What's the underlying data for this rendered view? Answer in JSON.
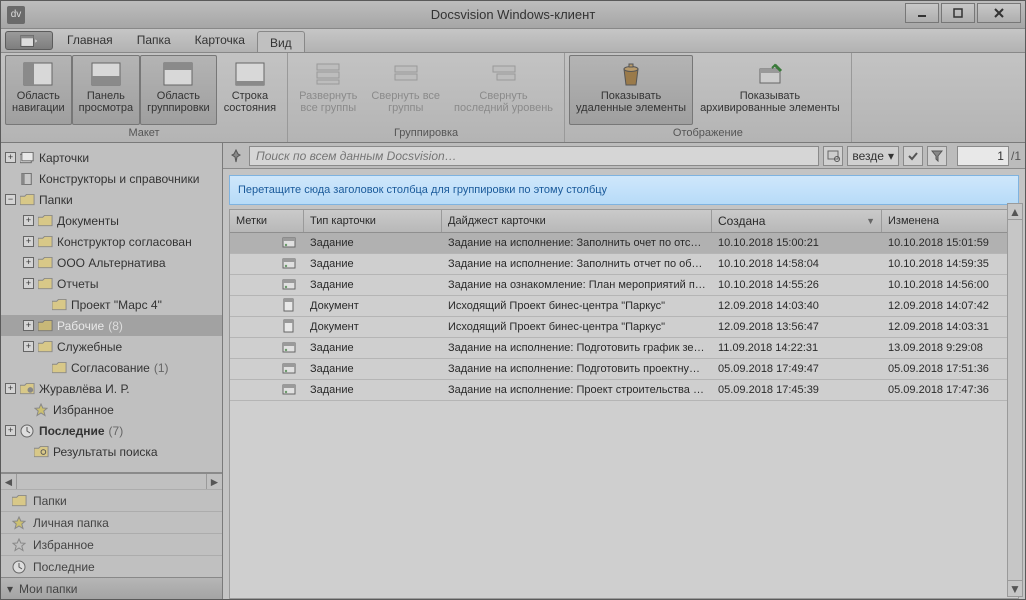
{
  "window": {
    "title": "Docsvision Windows-клиент"
  },
  "tabs": {
    "main": "Главная",
    "folder": "Папка",
    "card": "Карточка",
    "view": "Вид"
  },
  "ribbon": {
    "layout": {
      "label": "Макет",
      "nav_area": "Область\nнавигации",
      "preview_panel": "Панель\nпросмотра",
      "group_area": "Область\nгруппировки",
      "status_bar": "Строка\nсостояния"
    },
    "grouping": {
      "label": "Группировка",
      "expand_all": "Развернуть\nвсе группы",
      "collapse_all": "Свернуть все\nгруппы",
      "collapse_last": "Свернуть\nпоследний уровень"
    },
    "display": {
      "label": "Отображение",
      "show_deleted": "Показывать\nудаленные элементы",
      "show_archived": "Показывать\nархивированные элементы"
    }
  },
  "tree": {
    "cards": "Карточки",
    "constructors": "Конструкторы и справочники",
    "folders": "Папки",
    "documents": "Документы",
    "approval_ctor": "Конструктор согласован",
    "ooo_alt": "ООО Альтернатива",
    "reports": "Отчеты",
    "mars": "Проект \"Марс 4\"",
    "work": "Рабочие",
    "work_count": "(8)",
    "service": "Служебные",
    "approval": "Согласование",
    "approval_count": "(1)",
    "zhurav": "Журавлёва И. Р.",
    "favorites": "Избранное",
    "recent": "Последние",
    "recent_count": "(7)",
    "search_results": "Результаты поиска"
  },
  "nav": {
    "folders": "Папки",
    "personal": "Личная папка",
    "favorites": "Избранное",
    "recent": "Последние",
    "my_folders": "Мои папки"
  },
  "search": {
    "placeholder": "Поиск по всем данным Docsvision…",
    "scope": "везде",
    "page": "1",
    "total": "/1"
  },
  "group_hint": "Перетащите сюда заголовок столбца для группировки по этому столбцу",
  "columns": {
    "marks": "Метки",
    "type": "Тип карточки",
    "digest": "Дайджест карточки",
    "created": "Создана",
    "modified": "Изменена"
  },
  "rows": [
    {
      "type": "Задание",
      "digest": "Задание на исполнение: Заполнить очет по отсыпке…",
      "created": "10.10.2018 15:00:21",
      "modified": "10.10.2018 15:01:59"
    },
    {
      "type": "Задание",
      "digest": "Задание на исполнение: Заполнить отчет по обустро…",
      "created": "10.10.2018 14:58:04",
      "modified": "10.10.2018 14:59:35"
    },
    {
      "type": "Задание",
      "digest": "Задание на ознакомление: План мероприятий по по…",
      "created": "10.10.2018 14:55:26",
      "modified": "10.10.2018 14:56:00"
    },
    {
      "type": "Документ",
      "digest": "Исходящий Проект бинес-центра \"Паркус\"",
      "created": "12.09.2018 14:03:40",
      "modified": "12.09.2018 14:07:42"
    },
    {
      "type": "Документ",
      "digest": "Исходящий Проект бинес-центра \"Паркус\"",
      "created": "12.09.2018 13:56:47",
      "modified": "12.09.2018 14:03:31"
    },
    {
      "type": "Задание",
      "digest": "Задание на исполнение: Подготовить график земел…",
      "created": "11.09.2018 14:22:31",
      "modified": "13.09.2018 9:29:08"
    },
    {
      "type": "Задание",
      "digest": "Задание на исполнение: Подготовить проектную до…",
      "created": "05.09.2018 17:49:47",
      "modified": "05.09.2018 17:51:36"
    },
    {
      "type": "Задание",
      "digest": "Задание на исполнение: Проект строительства БЦ М…",
      "created": "05.09.2018 17:45:39",
      "modified": "05.09.2018 17:47:36"
    }
  ]
}
